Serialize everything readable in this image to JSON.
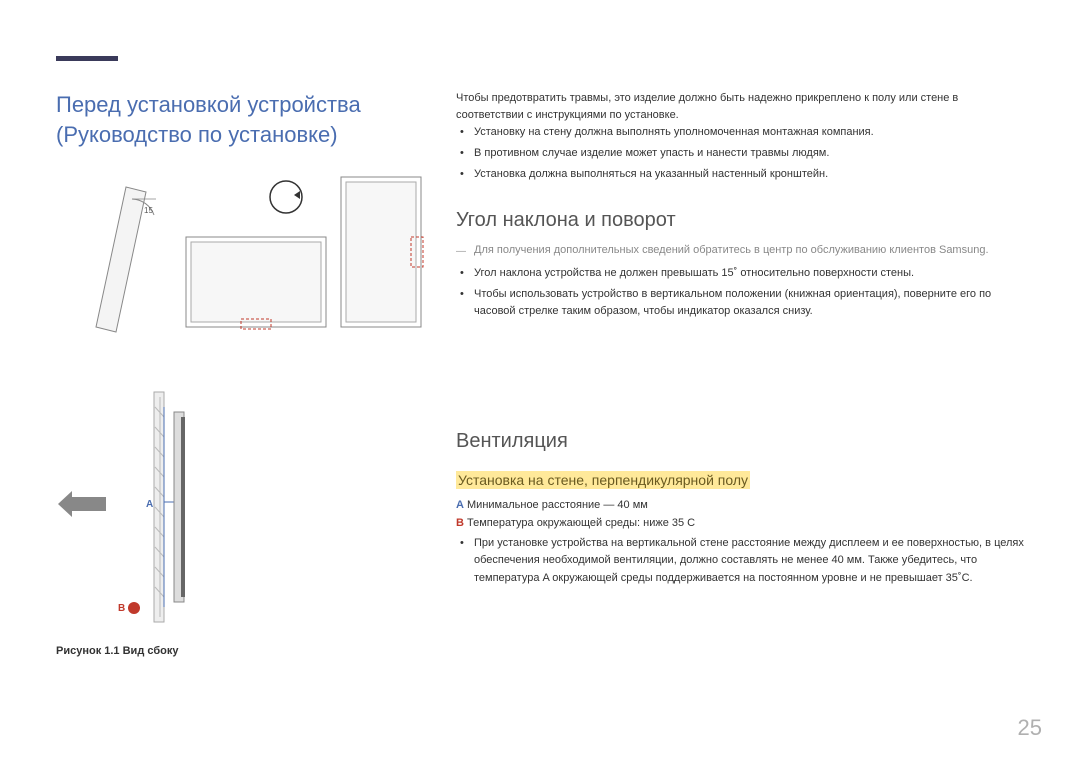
{
  "page_number": "25",
  "title": "Перед установкой устройства (Руководство по установке)",
  "intro_text": "Чтобы предотвратить травмы, это изделие должно быть надежно прикреплено к полу или стене в соответствии с инструкциями по установке.",
  "intro_bullets": [
    "Установку на стену должна выполнять уполномоченная монтажная компания.",
    "В противном случае изделие может упасть и нанести травмы людям.",
    "Установка должна выполняться на указанный настенный кронштейн."
  ],
  "tilt": {
    "heading": "Угол наклона и поворот",
    "note": "Для получения дополнительных сведений обратитесь в центр по обслуживанию клиентов Samsung.",
    "bullets": [
      "Угол наклона устройства не должен превышать 15˚ относительно поверхности стены.",
      "Чтобы использовать устройство в вертикальном положении (книжная ориентация), поверните его по часовой стрелке таким образом, чтобы индикатор оказался снизу."
    ],
    "angle_label": "15"
  },
  "ventilation": {
    "heading": "Вентиляция",
    "subheading": "Установка на стене, перпендикулярной полу",
    "line_a_label": "A",
    "line_a_text": " Минимальное расстояние — 40 мм",
    "line_b_label": "B",
    "line_b_text": " Температура окружающей среды: ниже 35 C",
    "bullets": [
      "При установке устройства на вертикальной стене расстояние между дисплеем и ее поверхностью, в целях обеспечения необходимой вентиляции, должно составлять не менее 40 мм. Также убедитесь, что температура A окружающей среды поддерживается на постоянном уровне и не превышает 35˚C."
    ]
  },
  "fig1_caption": "Рисунок 1.1 Вид сбоку",
  "markers": {
    "A": "A",
    "B": "B"
  },
  "colors": {
    "accent": "#4a6db0",
    "highlight": "#ffe99a",
    "red": "#c0392b"
  }
}
